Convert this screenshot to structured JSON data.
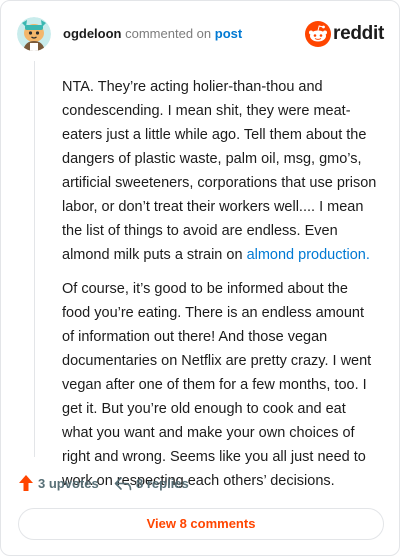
{
  "header": {
    "username": "ogdeloon",
    "action_text": "commented on",
    "target_text": "post",
    "logo_text": "reddit"
  },
  "comment": {
    "paragraph_1_text": "NTA. They’re acting holier-than-thou and condescending. I mean shit, they were meat-eaters just a little while ago. Tell them about the dangers of plastic waste, palm oil, msg, gmo’s, artificial sweeteners, corporations that use prison labor, or don’t treat their workers well.... I mean the list of things to avoid are endless. Even almond milk puts a strain on ",
    "paragraph_1_link": "almond production.",
    "paragraph_2": "Of course, it’s good to be informed about the food you’re eating. There is an endless amount of information out there! And those vegan documentaries on Netflix are pretty crazy. I went vegan after one of them for a few months, too. I get it. But you’re old enough to cook and eat what you want and make your own choices of right and wrong. Seems like you all just need to work on respecting each others’ decisions."
  },
  "actions": {
    "upvotes_label": "3 upvotes",
    "replies_label": "8 replies",
    "upvote_icon": "upvote-arrow-icon",
    "reply_icon": "reply-arrow-icon"
  },
  "footer": {
    "view_comments_label": "View 8 comments"
  },
  "colors": {
    "accent": "#ff4500",
    "link": "#0079d3",
    "muted": "#576f76"
  }
}
